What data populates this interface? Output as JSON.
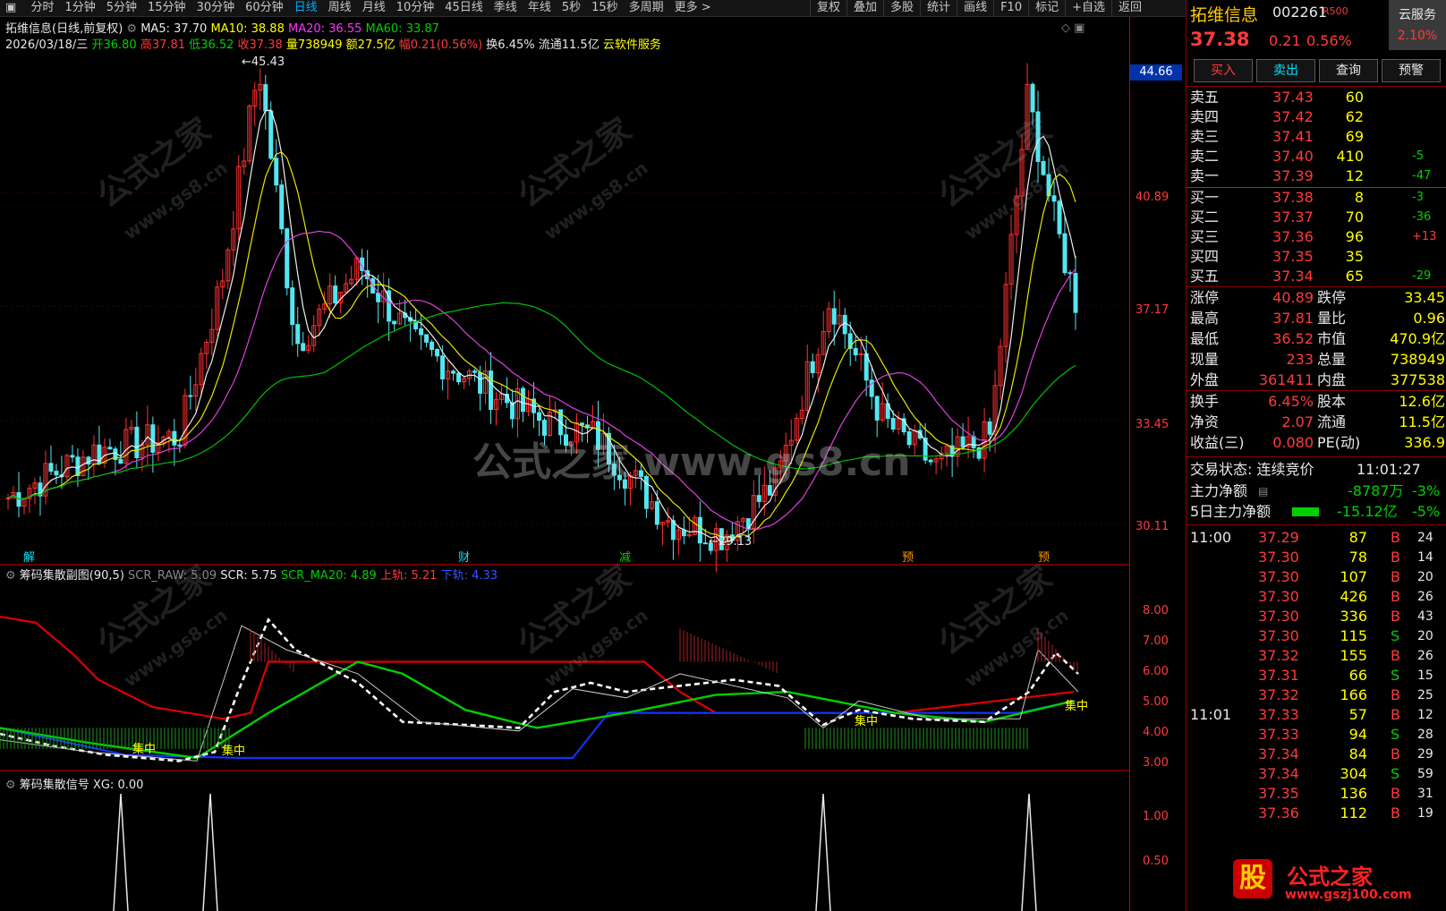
{
  "toolbar": {
    "tabs": [
      "分时",
      "1分钟",
      "5分钟",
      "15分钟",
      "30分钟",
      "60分钟",
      "日线",
      "周线",
      "月线",
      "10分钟",
      "45日线",
      "季线",
      "年线",
      "5秒",
      "15秒",
      "多周期",
      "更多 >"
    ],
    "active_tab": "日线",
    "right_tabs": [
      "复权",
      "叠加",
      "多股",
      "统计",
      "画线",
      "F10",
      "标记",
      "+自选",
      "返回"
    ]
  },
  "main_chart": {
    "title": "拓维信息(日线,前复权)",
    "ma": {
      "ma5": "MA5: 37.70",
      "ma10": "MA10: 38.88",
      "ma20": "MA20: 36.55",
      "ma60": "MA60: 33.87"
    },
    "date": "2026/03/18/三",
    "open": "开36.80",
    "high": "高37.81",
    "low": "低36.52",
    "close": "收37.38",
    "volume": "量738949",
    "amount": "额27.5亿",
    "change": "幅0.21(0.56%)",
    "turnover": "换6.45%",
    "float_cap": "流通11.5亿",
    "service": "云软件服务",
    "max_label": "45.43",
    "min_label": "29.13",
    "price_tag": "44.66",
    "axis": [
      "40.89",
      "37.17",
      "33.45",
      "30.11"
    ],
    "markers": [
      "解",
      "财",
      "减",
      "预",
      "预"
    ]
  },
  "sub_chart1": {
    "title": "筹码集散副图(90,5)",
    "scr_raw": "SCR_RAW: 5.09",
    "scr": "SCR: 5.75",
    "scr_ma20": "SCR_MA20: 4.89",
    "upper": "上轨: 5.21",
    "lower": "下轨: 4.33",
    "axis": [
      "8.00",
      "7.00",
      "6.00",
      "5.00",
      "4.00",
      "3.00"
    ],
    "focus_label": "集中"
  },
  "sub_chart2": {
    "title": "筹码集散信号",
    "xg": "XG: 0.00",
    "axis": [
      "1.00",
      "0.50"
    ]
  },
  "watermark": {
    "text": "公式之家 www.gs8.cn",
    "small": "公式之家",
    "url_small": "www.gs8.cn"
  },
  "quote": {
    "name": "拓维信息",
    "code": "002261",
    "tag": "R500",
    "price": "37.38",
    "chg": "0.21",
    "pct": "0.56%",
    "cloud": "云服务",
    "cloud_pct": "2.10%",
    "buttons": [
      "买入",
      "卖出",
      "查询",
      "预警"
    ],
    "asks": [
      {
        "label": "卖五",
        "price": "37.43",
        "vol": "60",
        "extra": ""
      },
      {
        "label": "卖四",
        "price": "37.42",
        "vol": "62",
        "extra": ""
      },
      {
        "label": "卖三",
        "price": "37.41",
        "vol": "69",
        "extra": ""
      },
      {
        "label": "卖二",
        "price": "37.40",
        "vol": "410",
        "extra": "-5"
      },
      {
        "label": "卖一",
        "price": "37.39",
        "vol": "12",
        "extra": "-47"
      }
    ],
    "bids": [
      {
        "label": "买一",
        "price": "37.38",
        "vol": "8",
        "extra": "-3"
      },
      {
        "label": "买二",
        "price": "37.37",
        "vol": "70",
        "extra": "-36"
      },
      {
        "label": "买三",
        "price": "37.36",
        "vol": "96",
        "extra": "+13"
      },
      {
        "label": "买四",
        "price": "37.35",
        "vol": "35",
        "extra": ""
      },
      {
        "label": "买五",
        "price": "37.34",
        "vol": "65",
        "extra": "-29"
      }
    ],
    "stats": [
      {
        "l1": "涨停",
        "v1": "40.89",
        "l2": "跌停",
        "v2": "33.45"
      },
      {
        "l1": "最高",
        "v1": "37.81",
        "l2": "量比",
        "v2": "0.96"
      },
      {
        "l1": "最低",
        "v1": "36.52",
        "l2": "市值",
        "v2": "470.9亿"
      },
      {
        "l1": "现量",
        "v1": "233",
        "l2": "总量",
        "v2": "738949"
      },
      {
        "l1": "外盘",
        "v1": "361411",
        "l2": "内盘",
        "v2": "377538"
      }
    ],
    "stats2": [
      {
        "l1": "换手",
        "v1": "6.45%",
        "l2": "股本",
        "v2": "12.6亿"
      },
      {
        "l1": "净资",
        "v1": "2.07",
        "l2": "流通",
        "v2": "11.5亿"
      },
      {
        "l1": "收益(三)",
        "v1": "0.080",
        "l2": "PE(动)",
        "v2": "336.9"
      }
    ],
    "status_label": "交易状态: 连续竞价",
    "status_time": "11:01:27",
    "main_net_label": "主力净额",
    "main_net": "-8787万",
    "main_net_pct": "-3%",
    "main5_label": "5日主力净额",
    "main5": "-15.12亿",
    "main5_pct": "-5%",
    "ticks_time1": "11:00",
    "ticks_time2": "11:01",
    "ticks": [
      {
        "p": "37.29",
        "v": "87",
        "s": "B",
        "x": "24"
      },
      {
        "p": "37.30",
        "v": "78",
        "s": "B",
        "x": "14"
      },
      {
        "p": "37.30",
        "v": "107",
        "s": "B",
        "x": "20"
      },
      {
        "p": "37.30",
        "v": "426",
        "s": "B",
        "x": "26"
      },
      {
        "p": "37.30",
        "v": "336",
        "s": "B",
        "x": "43"
      },
      {
        "p": "37.30",
        "v": "115",
        "s": "S",
        "x": "20"
      },
      {
        "p": "37.32",
        "v": "155",
        "s": "B",
        "x": "26"
      },
      {
        "p": "37.31",
        "v": "66",
        "s": "S",
        "x": "15"
      },
      {
        "p": "37.32",
        "v": "166",
        "s": "B",
        "x": "25"
      },
      {
        "p": "37.33",
        "v": "57",
        "s": "B",
        "x": "12"
      },
      {
        "p": "37.33",
        "v": "94",
        "s": "S",
        "x": "28"
      },
      {
        "p": "37.34",
        "v": "84",
        "s": "B",
        "x": "29"
      },
      {
        "p": "37.34",
        "v": "304",
        "s": "S",
        "x": "59"
      },
      {
        "p": "37.35",
        "v": "136",
        "s": "B",
        "x": "31"
      },
      {
        "p": "37.36",
        "v": "112",
        "s": "B",
        "x": "19"
      }
    ],
    "logo_text": "公式之家",
    "logo_url": "www.gszj100.com",
    "logo_char": "股"
  }
}
